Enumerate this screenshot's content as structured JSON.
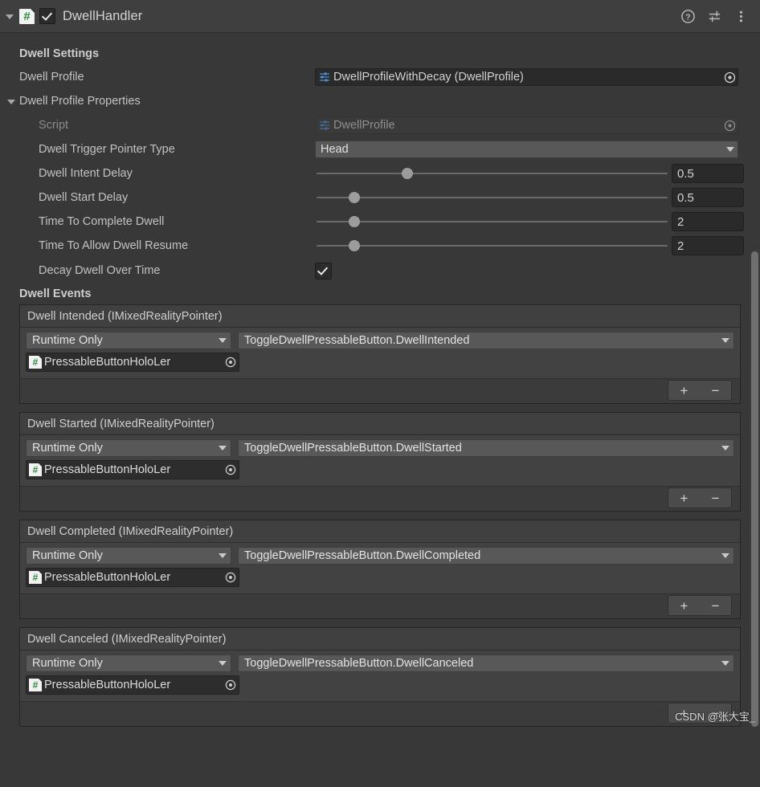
{
  "component": {
    "title": "DwellHandler",
    "enabled": true,
    "script_icon": "csharp-script-icon",
    "foldout_expanded": true,
    "header_icons": [
      {
        "name": "help-icon",
        "label": "?"
      },
      {
        "name": "preset-icon",
        "label": ""
      },
      {
        "name": "more-menu-icon",
        "label": ""
      }
    ]
  },
  "dwell_settings": {
    "section_label": "Dwell Settings",
    "dwell_profile": {
      "label": "Dwell Profile",
      "value": "DwellProfileWithDecay (DwellProfile)",
      "icon": "scriptable-object-icon",
      "picker": "object-picker-icon"
    }
  },
  "dwell_profile_properties": {
    "foldout_label": "Dwell Profile Properties",
    "expanded": true,
    "script": {
      "label": "Script",
      "value": "DwellProfile",
      "disabled": true
    },
    "pointer_type": {
      "label": "Dwell Trigger Pointer Type",
      "value": "Head"
    },
    "sliders": [
      {
        "label": "Dwell Intent Delay",
        "value": "0.5",
        "fill_percent": 26
      },
      {
        "label": "Dwell Start Delay",
        "value": "0.5",
        "fill_percent": 11
      },
      {
        "label": "Time To Complete Dwell",
        "value": "2",
        "fill_percent": 11
      },
      {
        "label": "Time To Allow Dwell Resume",
        "value": "2",
        "fill_percent": 11
      }
    ],
    "decay": {
      "label": "Decay Dwell Over Time",
      "checked": true
    }
  },
  "dwell_events": {
    "section_label": "Dwell Events",
    "entry_mode_label": "Runtime Only",
    "entry_object_label": "PressableButtonHoloLer",
    "add_label": "+",
    "remove_label": "−",
    "events": [
      {
        "header": "Dwell Intended (IMixedRealityPointer)",
        "method": "ToggleDwellPressableButton.DwellIntended"
      },
      {
        "header": "Dwell Started (IMixedRealityPointer)",
        "method": "ToggleDwellPressableButton.DwellStarted"
      },
      {
        "header": "Dwell Completed (IMixedRealityPointer)",
        "method": "ToggleDwellPressableButton.DwellCompleted"
      },
      {
        "header": "Dwell Canceled (IMixedRealityPointer)",
        "method": "ToggleDwellPressableButton.DwellCanceled"
      }
    ]
  },
  "watermark": "CSDN @张大宝_",
  "colors": {
    "window_bg": "#383838",
    "header_bg": "#3f3f3f",
    "field_bg": "#2a2a2a",
    "popup_bg": "#585858",
    "event_bg": "#424242",
    "accent_blue": "#4b90d6",
    "accent_green": "#2a8f3a"
  }
}
